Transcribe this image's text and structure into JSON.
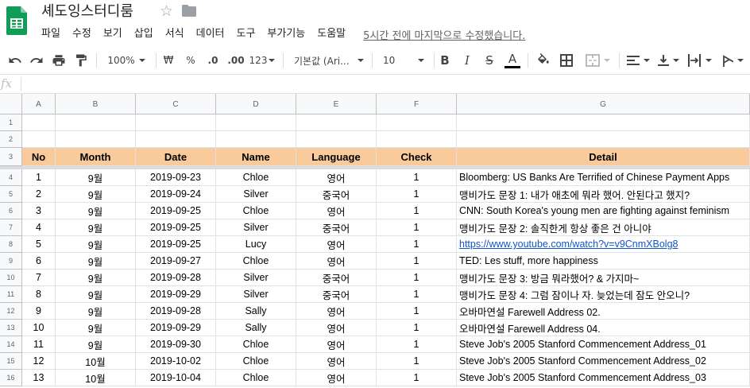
{
  "app": {
    "title": "셰도잉스터디룸",
    "star_glyph": "☆",
    "icons": [
      "sheets-logo-icon",
      "star-icon",
      "folder-icon"
    ],
    "brand_color": "#0f9d58"
  },
  "menu": {
    "items": [
      "파일",
      "수정",
      "보기",
      "삽입",
      "서식",
      "데이터",
      "도구",
      "부가기능",
      "도움말"
    ],
    "last_edit": "5시간 전에 마지막으로 수정했습니다."
  },
  "toolbar": {
    "zoom": "100%",
    "currency": "₩",
    "percent": "%",
    "decimal_decrease": ".0",
    "decimal_increase": ".00",
    "number_format": "123",
    "font": "기본값 (Ari...",
    "font_size": "10",
    "bold": "B",
    "italic": "I",
    "strike": "S",
    "text_color": "A",
    "icons": [
      "undo-icon",
      "redo-icon",
      "print-icon",
      "paint-format-icon",
      "fill-color-icon",
      "borders-icon",
      "merge-cells-icon",
      "align-left-icon",
      "vertical-align-icon",
      "text-wrap-icon",
      "text-rotate-icon"
    ]
  },
  "formula_bar": {
    "label": "fx",
    "value": ""
  },
  "grid": {
    "columns": [
      "A",
      "B",
      "C",
      "D",
      "E",
      "F",
      "G"
    ],
    "header_fill": "#f9cb9c",
    "rows": [
      {
        "num": "1",
        "cells": [
          "",
          "",
          "",
          "",
          "",
          "",
          ""
        ]
      },
      {
        "num": "2",
        "cells": [
          "",
          "",
          "",
          "",
          "",
          "",
          ""
        ]
      },
      {
        "num": "3",
        "header": true,
        "cells": [
          "No",
          "Month",
          "Date",
          "Name",
          "Language",
          "Check",
          "Detail"
        ]
      },
      {
        "num": "4",
        "cells": [
          "1",
          "9월",
          "2019-09-23",
          "Chloe",
          "영어",
          "1",
          "Bloomberg: US Banks Are Terrified of Chinese Payment Apps"
        ]
      },
      {
        "num": "5",
        "cells": [
          "2",
          "9월",
          "2019-09-24",
          "Silver",
          "중국어",
          "1",
          "맹비가도 문장 1: 내가 애초에 뭐라 했어. 안된다고 했지?"
        ]
      },
      {
        "num": "6",
        "cells": [
          "3",
          "9월",
          "2019-09-25",
          "Chloe",
          "영어",
          "1",
          "CNN: South Korea's young men are fighting against feminism"
        ]
      },
      {
        "num": "7",
        "cells": [
          "4",
          "9월",
          "2019-09-25",
          "Silver",
          "중국어",
          "1",
          "맹비가도 문장 2: 솔직한게 항상 좋은 건 아니야"
        ]
      },
      {
        "num": "8",
        "cells": [
          "5",
          "9월",
          "2019-09-25",
          "Lucy",
          "영어",
          "1",
          "https://www.youtube.com/watch?v=v9CnmXBolg8"
        ],
        "link_col": 6
      },
      {
        "num": "9",
        "cells": [
          "6",
          "9월",
          "2019-09-27",
          "Chloe",
          "영어",
          "1",
          "TED: Les stuff, more happiness"
        ]
      },
      {
        "num": "10",
        "cells": [
          "7",
          "9월",
          "2019-09-28",
          "Silver",
          "중국어",
          "1",
          "맹비가도 문장 3: 방금 뭐라했어? & 가지마~"
        ]
      },
      {
        "num": "11",
        "cells": [
          "8",
          "9월",
          "2019-09-29",
          "Silver",
          "중국어",
          "1",
          "맹비가도 문장 4: 그럼 잠이나 자. 늦었는데 잠도 안오니?"
        ]
      },
      {
        "num": "12",
        "cells": [
          "9",
          "9월",
          "2019-09-28",
          "Sally",
          "영어",
          "1",
          "오바마연설 Farewell Address 02."
        ]
      },
      {
        "num": "13",
        "cells": [
          "10",
          "9월",
          "2019-09-29",
          "Sally",
          "영어",
          "1",
          "오바마연설 Farewell Address 04."
        ]
      },
      {
        "num": "14",
        "cells": [
          "11",
          "9월",
          "2019-09-30",
          "Chloe",
          "영어",
          "1",
          "Steve Job's 2005 Stanford Commencement Address_01"
        ]
      },
      {
        "num": "15",
        "cells": [
          "12",
          "10월",
          "2019-10-02",
          "Chloe",
          "영어",
          "1",
          "Steve Job's 2005 Stanford Commencement Address_02"
        ]
      },
      {
        "num": "16",
        "cells": [
          "13",
          "10월",
          "2019-10-04",
          "Chloe",
          "영어",
          "1",
          "Steve Job's 2005 Stanford Commencement Address_03"
        ]
      }
    ]
  }
}
